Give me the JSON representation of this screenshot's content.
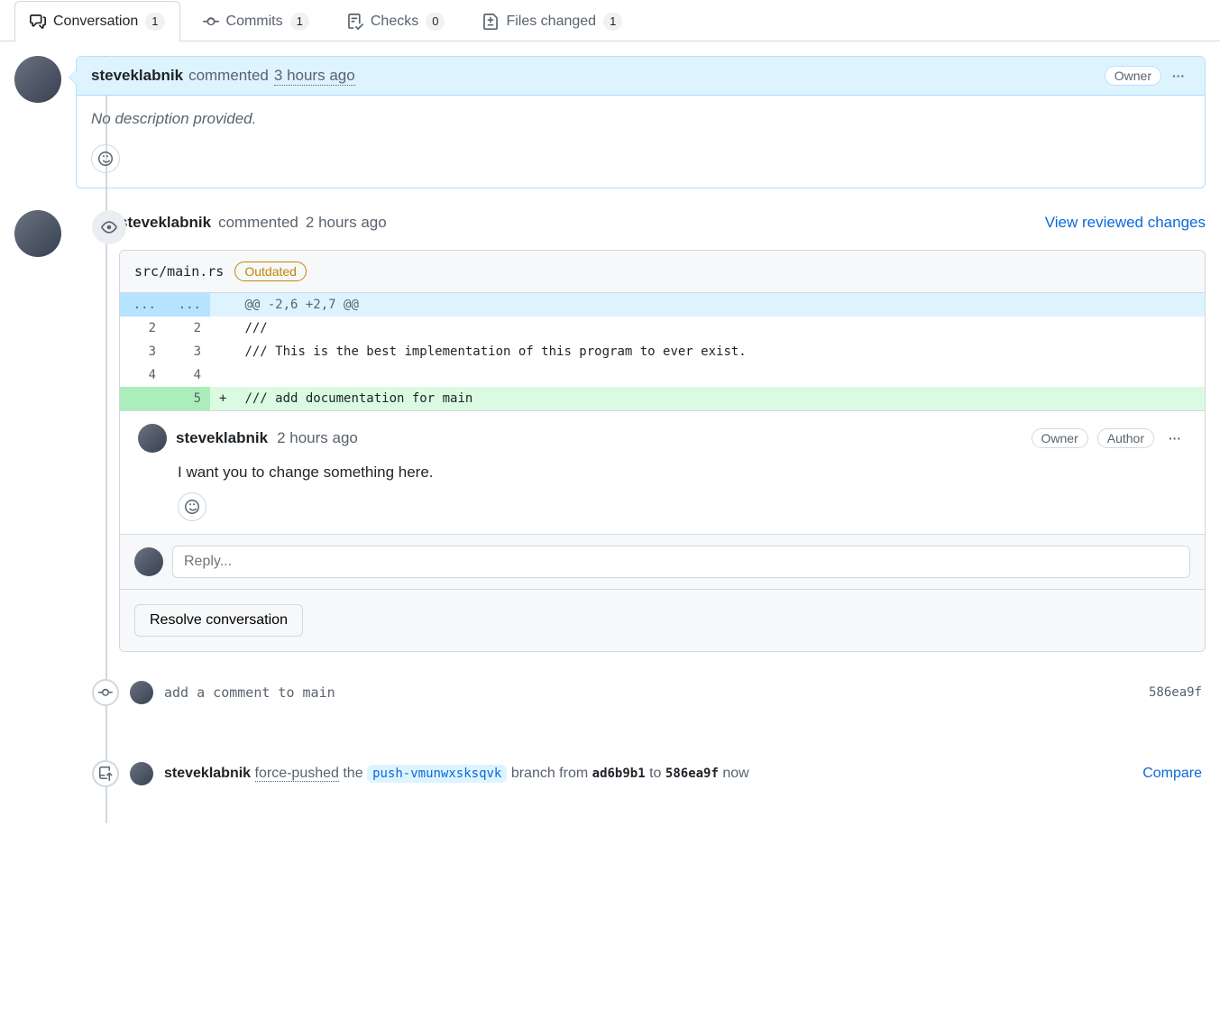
{
  "tabs": {
    "conversation": {
      "label": "Conversation",
      "count": "1"
    },
    "commits": {
      "label": "Commits",
      "count": "1"
    },
    "checks": {
      "label": "Checks",
      "count": "0"
    },
    "files": {
      "label": "Files changed",
      "count": "1"
    }
  },
  "mainComment": {
    "author": "steveklabnik",
    "verb": "commented",
    "timestamp": "3 hours ago",
    "ownerBadge": "Owner",
    "body": "No description provided."
  },
  "review": {
    "author": "steveklabnik",
    "verb": "commented",
    "timestamp": "2 hours ago",
    "link": "View reviewed changes",
    "file": {
      "path": "src/main.rs",
      "outdatedLabel": "Outdated",
      "hunkHeader": "@@ -2,6 +2,7 @@",
      "lines": [
        {
          "oldNum": "2",
          "newNum": "2",
          "marker": "",
          "code": "///"
        },
        {
          "oldNum": "3",
          "newNum": "3",
          "marker": "",
          "code": "/// This is the best implementation of this program to ever exist."
        },
        {
          "oldNum": "4",
          "newNum": "4",
          "marker": "",
          "code": ""
        },
        {
          "oldNum": "",
          "newNum": "5",
          "marker": "+",
          "code": "/// add documentation for main",
          "type": "add"
        }
      ],
      "hunkDotsOld": "...",
      "hunkDotsNew": "..."
    },
    "lineComment": {
      "author": "steveklabnik",
      "timestamp": "2 hours ago",
      "badges": {
        "owner": "Owner",
        "author": "Author"
      },
      "body": "I want you to change something here."
    },
    "replyPlaceholder": "Reply...",
    "resolveLabel": "Resolve conversation"
  },
  "commitEvent": {
    "message": "add a comment to main",
    "sha": "586ea9f"
  },
  "pushEvent": {
    "author": "steveklabnik",
    "action": "force-pushed",
    "the": "the",
    "branch": "push-vmunwxsksqvk",
    "branchWord": "branch from",
    "fromSha": "ad6b9b1",
    "to": "to",
    "toSha": "586ea9f",
    "when": "now",
    "compare": "Compare"
  }
}
